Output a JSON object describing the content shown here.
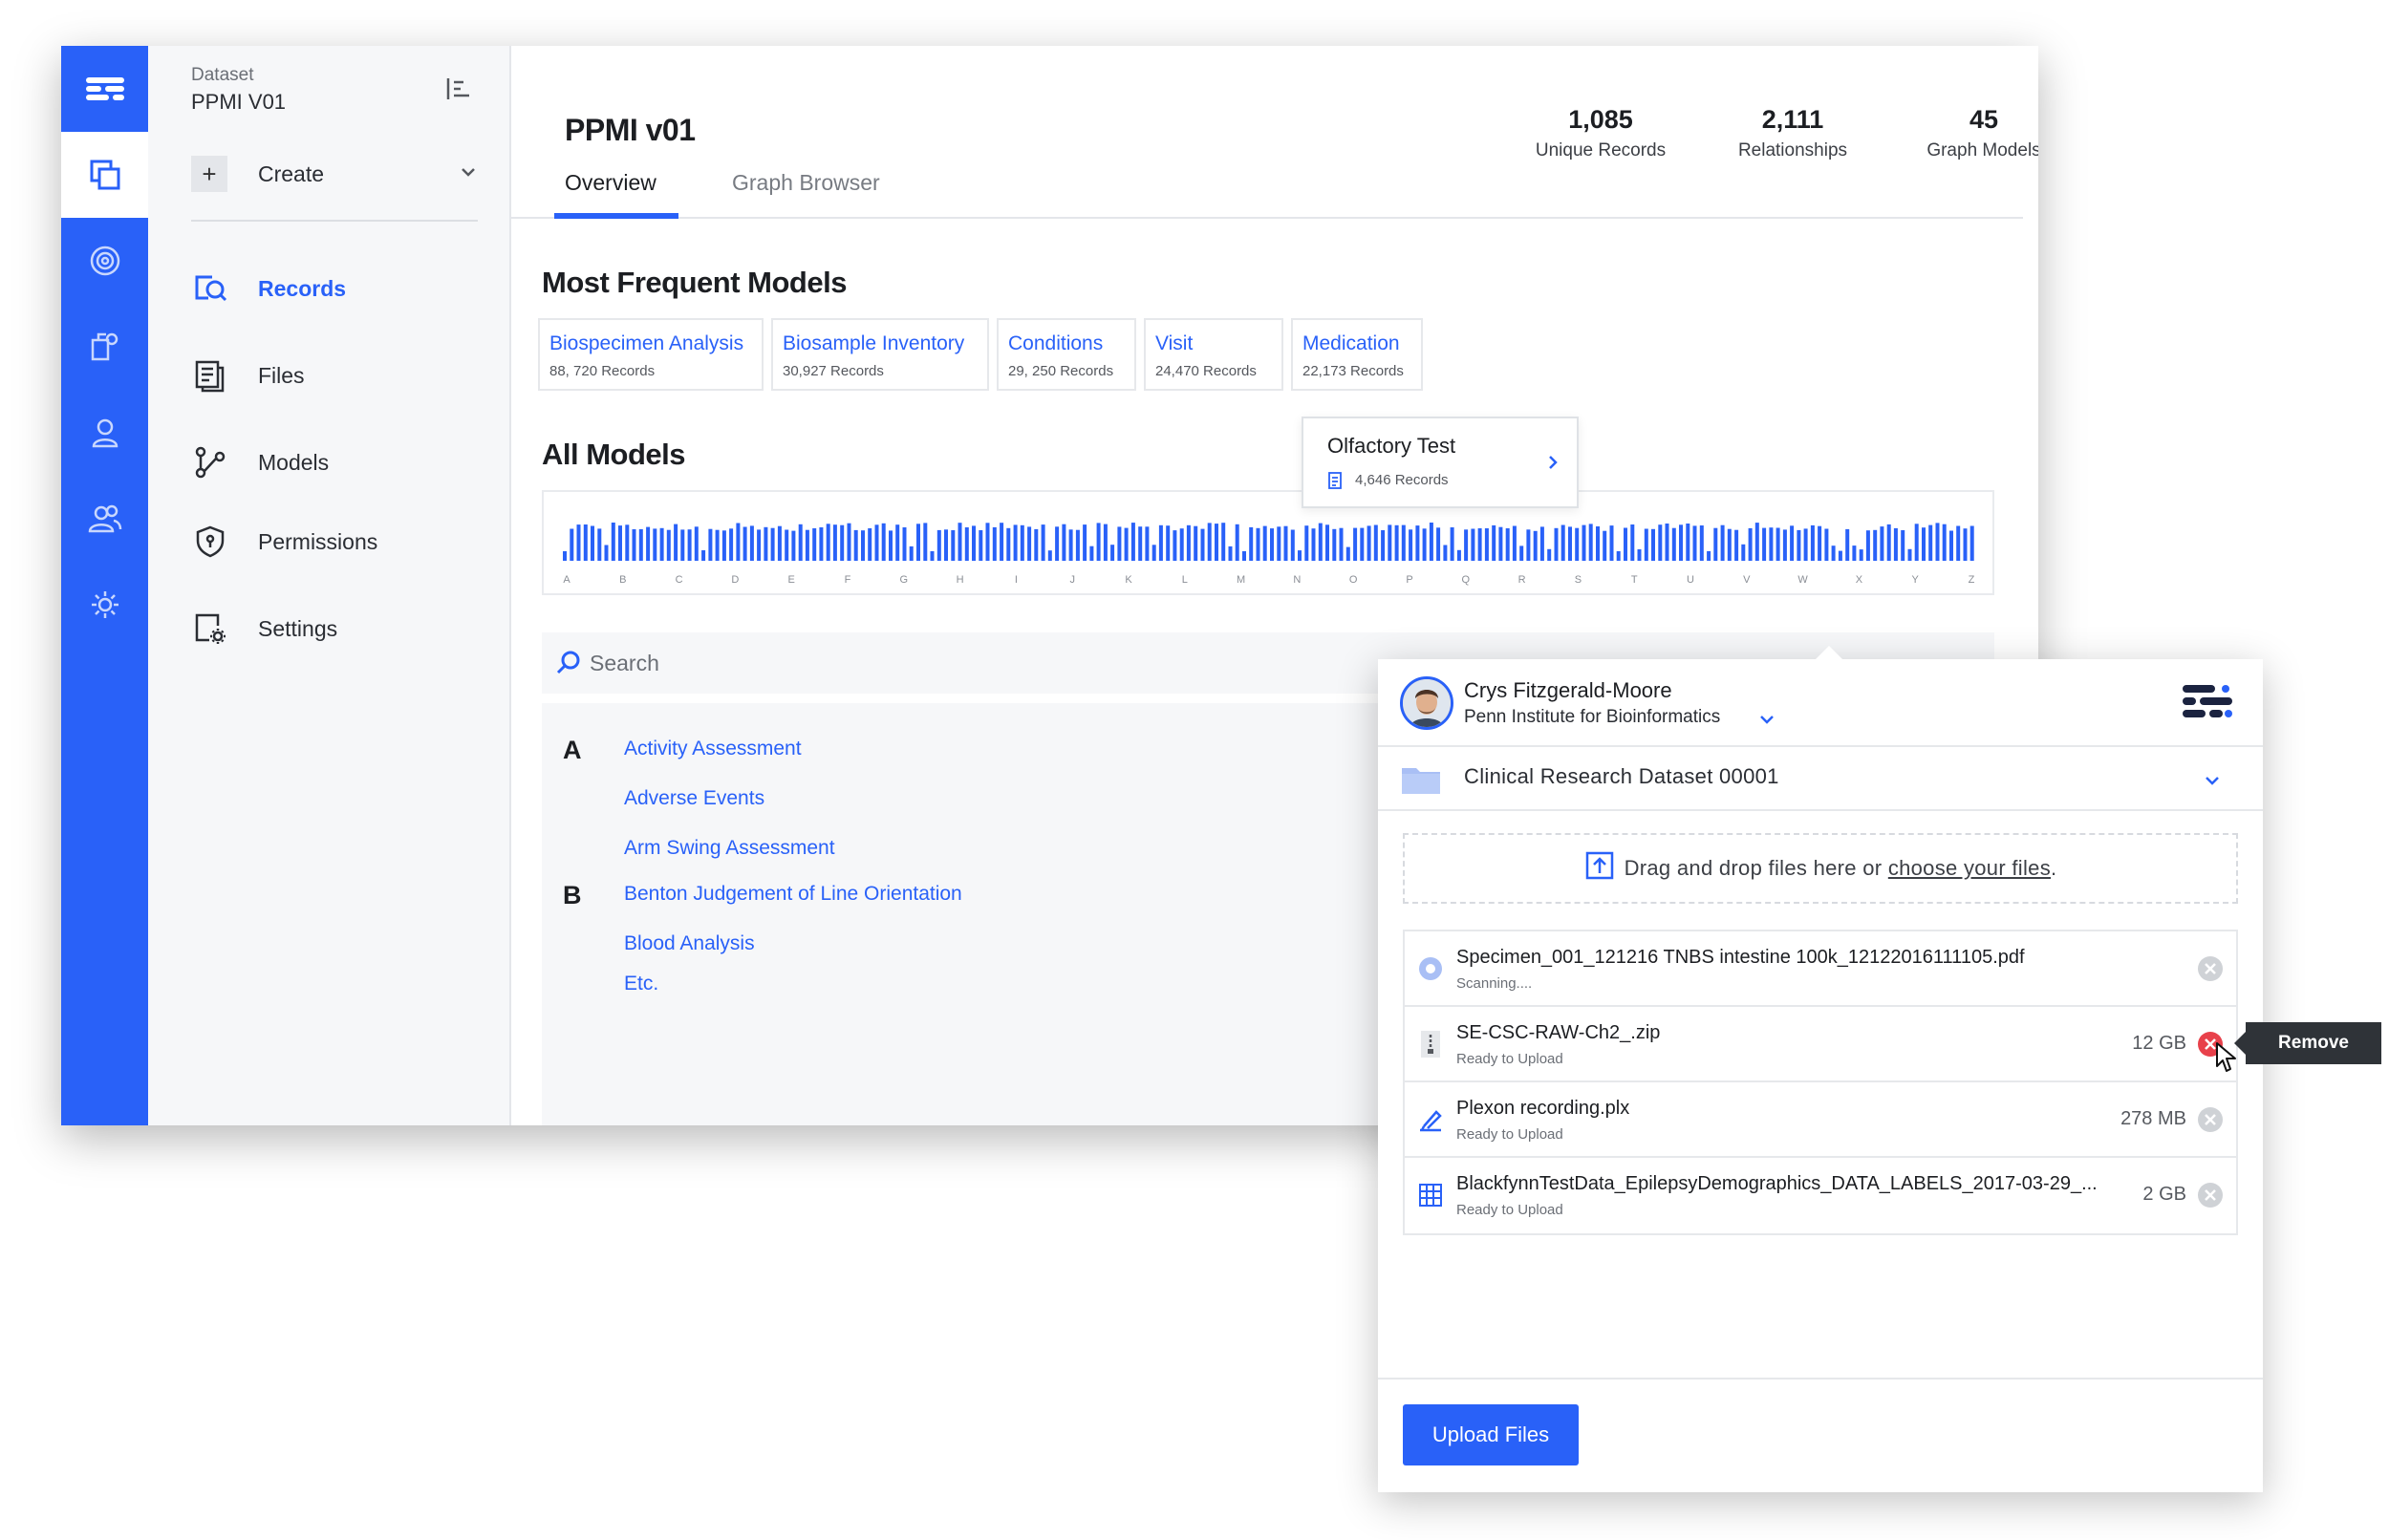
{
  "sidebar": {
    "dataset_caption": "Dataset",
    "dataset_name": "PPMI V01",
    "create_label": "Create",
    "nav": [
      {
        "label": "Records",
        "icon": "records-icon",
        "active": true
      },
      {
        "label": "Files",
        "icon": "files-icon",
        "active": false
      },
      {
        "label": "Models",
        "icon": "models-icon",
        "active": false
      },
      {
        "label": "Permissions",
        "icon": "shield-icon",
        "active": false
      },
      {
        "label": "Settings",
        "icon": "settings-icon",
        "active": false
      }
    ]
  },
  "header": {
    "title": "PPMI v01",
    "tabs": [
      {
        "label": "Overview",
        "active": true
      },
      {
        "label": "Graph Browser",
        "active": false
      }
    ],
    "stats": [
      {
        "value": "1,085",
        "label": "Unique Records"
      },
      {
        "value": "2,111",
        "label": "Relationships"
      },
      {
        "value": "45",
        "label": "Graph Models"
      }
    ]
  },
  "frequent": {
    "title": "Most Frequent Models",
    "cards": [
      {
        "name": "Biospecimen Analysis",
        "count": "88, 720 Records"
      },
      {
        "name": "Biosample Inventory",
        "count": "30,927 Records"
      },
      {
        "name": "Conditions",
        "count": "29, 250 Records"
      },
      {
        "name": "Visit",
        "count": "24,470 Records"
      },
      {
        "name": "Medication",
        "count": "22,173 Records"
      }
    ]
  },
  "all_models": {
    "title": "All Models",
    "axis_letters": [
      "A",
      "B",
      "C",
      "D",
      "E",
      "F",
      "G",
      "H",
      "I",
      "J",
      "K",
      "L",
      "M",
      "N",
      "O",
      "P",
      "Q",
      "R",
      "S",
      "T",
      "U",
      "V",
      "W",
      "X",
      "Y",
      "Z"
    ],
    "tooltip": {
      "title": "Olfactory Test",
      "count": "4,646 Records"
    },
    "search_placeholder": "Search",
    "groups": [
      {
        "letter": "A",
        "items": [
          "Activity Assessment",
          "Adverse Events",
          "Arm Swing Assessment"
        ]
      },
      {
        "letter": "B",
        "items": [
          "Benton Judgement of Line Orientation",
          "Blood Analysis",
          "Etc."
        ]
      }
    ]
  },
  "upload": {
    "user_name": "Crys Fitzgerald-Moore",
    "org": "Penn Institute for Bioinformatics",
    "dataset": "Clinical Research Dataset 00001",
    "dropzone_text": "Drag and drop files here or",
    "dropzone_link": "choose your files",
    "dropzone_end": ".",
    "files": [
      {
        "name": "Specimen_001_121216 TNBS intestine 100k_12122016111105.pdf",
        "status": "Scanning....",
        "size": "",
        "icon": "scanning-icon"
      },
      {
        "name": "SE-CSC-RAW-Ch2_.zip",
        "status": "Ready to Upload",
        "size": "12 GB",
        "icon": "zip-file-icon"
      },
      {
        "name": "Plexon recording.plx",
        "status": "Ready to Upload",
        "size": "278 MB",
        "icon": "recording-file-icon"
      },
      {
        "name": "BlackfynnTestData_EpilepsyDemographics_DATA_LABELS_2017-03-29_...",
        "status": "Ready to Upload",
        "size": "2 GB",
        "icon": "table-file-icon"
      }
    ],
    "upload_button": "Upload Files",
    "remove_tooltip": "Remove"
  },
  "colors": {
    "accent": "#2961f8",
    "danger": "#e8414b"
  }
}
